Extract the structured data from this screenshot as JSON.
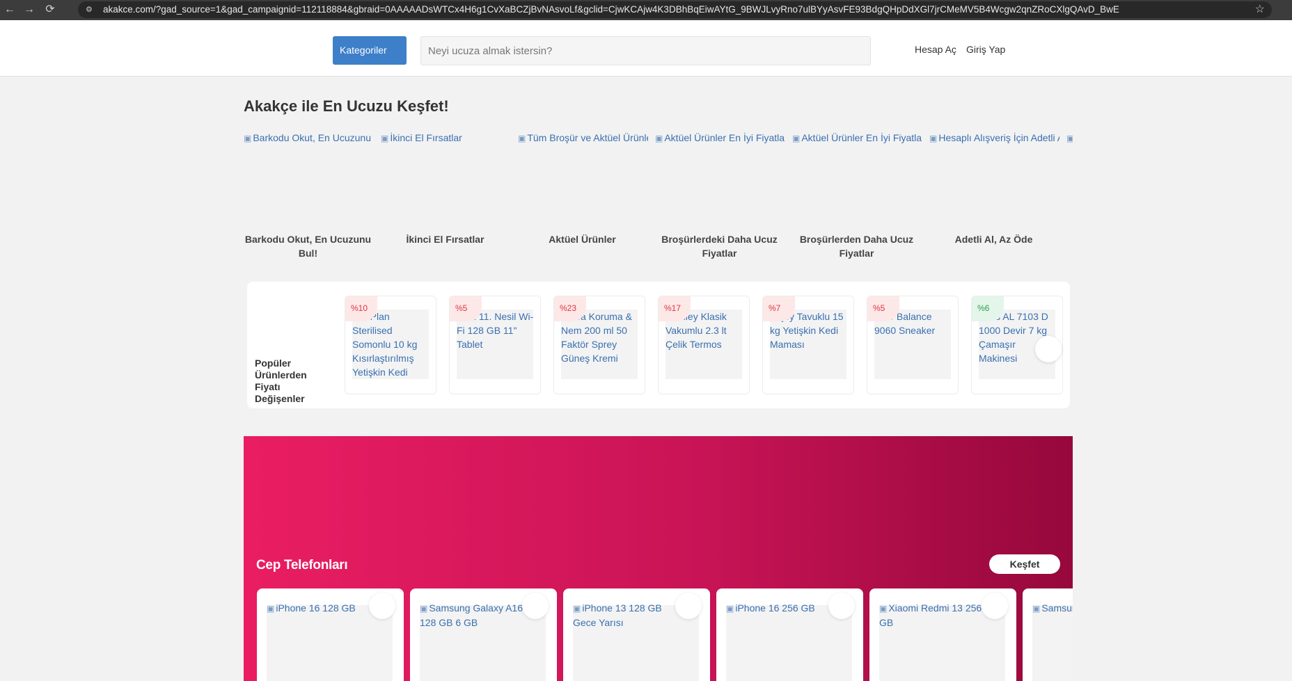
{
  "browser": {
    "url": "akakce.com/?gad_source=1&gad_campaignid=112118884&gbraid=0AAAAADsWTCx4H6g1CvXaBCZjBvNAsvoLf&gclid=CjwKCAjw4K3DBhBqEiwAYtG_9BWJLvyRno7ulBYyAsvFE93BdgQHpDdXGl7jrCMeMV5B4Wcgw2qnZRoCXlgQAvD_BwE",
    "back_icon": "←",
    "forward_icon": "→",
    "reload_icon": "⟳",
    "site_info_icon": "⚙",
    "star_icon": "☆"
  },
  "header": {
    "categories_label": "Kategoriler",
    "search_placeholder": "Neyi ucuza almak istersin?",
    "register_label": "Hesap Aç",
    "login_label": "Giriş Yap"
  },
  "main": {
    "title": "Akakçe ile En Ucuzu Keşfet!",
    "shortcuts": [
      {
        "img_alt": "Barkodu Okut, En Ucuzunu Bul!",
        "label": "Barkodu Okut, En Ucuzunu Bul!"
      },
      {
        "img_alt": "İkinci El Fırsatlar",
        "label": "İkinci El Fırsatlar"
      },
      {
        "img_alt": "Tüm Broşür ve Aktüel Ürünler",
        "label": "Aktüel Ürünler"
      },
      {
        "img_alt": "Aktüel Ürünler En İyi Fiyatlar",
        "label": "Broşürlerdeki Daha Ucuz Fiyatlar"
      },
      {
        "img_alt": "Aktüel Ürünler En İyi Fiyatlar",
        "label": "Broşürlerden Daha Ucuz Fiyatlar"
      },
      {
        "img_alt": "Hesaplı Alışveriş İçin Adetli Al",
        "label": "Adetli Al, Az Öde"
      },
      {
        "img_alt": "",
        "label": ""
      }
    ],
    "popular": {
      "title": "Popüler Ürünlerden Fiyatı Değişenler",
      "items": [
        {
          "badge": "%10",
          "name": "Pro Plan Sterilised Somonlu 10 kg Kısırlaştırılmış Yetişkin Kedi"
        },
        {
          "badge": "%5",
          "name": "iPad 11. Nesil Wi-Fi 128 GB 11\" Tablet"
        },
        {
          "badge": "%23",
          "name": "Nivea Koruma & Nem 200 ml 50 Faktör Sprey Güneş Kremi"
        },
        {
          "badge": "%17",
          "name": "Stanley Klasik Vakumlu 2.3 lt Çelik Termos"
        },
        {
          "badge": "%7",
          "name": "Enjoy Tavuklu 15 kg Yetişkin Kedi Maması"
        },
        {
          "badge": "%5",
          "name": "New Balance 9060 Sneaker"
        },
        {
          "badge": "%6",
          "name": "Altus AL 7103 D 1000 Devir 7 kg Çamaşır Makinesi"
        }
      ]
    },
    "phones": {
      "title": "Cep Telefonları",
      "discover_label": "Keşfet",
      "items": [
        {
          "name": "iPhone 16 128 GB"
        },
        {
          "name": "Samsung Galaxy A16 128 GB 6 GB"
        },
        {
          "name": "iPhone 13 128 GB Gece Yarısı"
        },
        {
          "name": "iPhone 16 256 GB"
        },
        {
          "name": "Xiaomi Redmi 13 256 GB"
        },
        {
          "name": "Samsung GB"
        }
      ]
    }
  }
}
